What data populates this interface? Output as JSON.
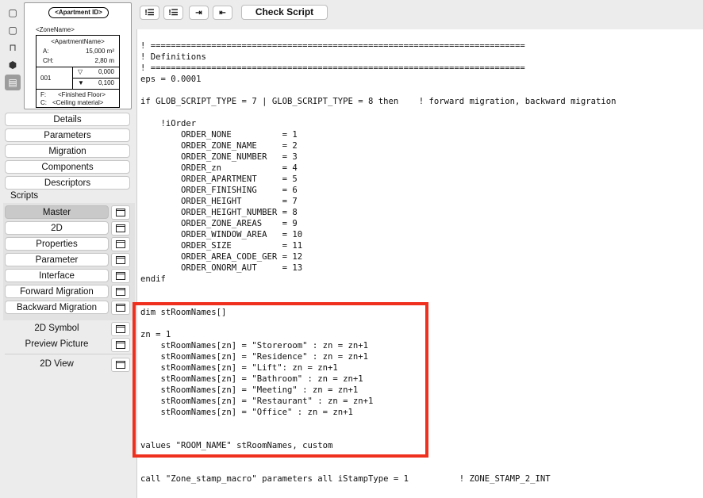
{
  "preview": {
    "apartment_id": "<Apartment ID>",
    "zone_name": "<ZoneName>",
    "apartment_name": "<ApartmentName>",
    "area_label": "A:",
    "area_value": "15,000 m²",
    "ch_label": "CH:",
    "ch_value": "2,80 m",
    "number": "001",
    "up_value": "0,000",
    "down_value": "0,100",
    "floor_label": "F:",
    "floor_value": "<Finished Floor>",
    "ceiling_label": "C:",
    "ceiling_value": "<Ceiling material>"
  },
  "nav": {
    "details": "Details",
    "parameters": "Parameters",
    "migration": "Migration",
    "components": "Components",
    "descriptors": "Descriptors"
  },
  "scripts": {
    "header": "Scripts",
    "items": [
      "Master",
      "2D",
      "Properties",
      "Parameter",
      "Interface",
      "Forward Migration",
      "Backward Migration"
    ],
    "symbol": "2D Symbol",
    "preview_picture": "Preview Picture",
    "view_2d": "2D View"
  },
  "toolbar": {
    "check_script": "Check Script"
  },
  "code": "! ==========================================================================\n! Definitions\n! ==========================================================================\neps = 0.0001\n\nif GLOB_SCRIPT_TYPE = 7 | GLOB_SCRIPT_TYPE = 8 then    ! forward migration, backward migration\n\n    !iOrder\n        ORDER_NONE          = 1\n        ORDER_ZONE_NAME     = 2\n        ORDER_ZONE_NUMBER   = 3\n        ORDER_zn            = 4\n        ORDER_APARTMENT     = 5\n        ORDER_FINISHING     = 6\n        ORDER_HEIGHT        = 7\n        ORDER_HEIGHT_NUMBER = 8\n        ORDER_ZONE_AREAS    = 9\n        ORDER_WINDOW_AREA   = 10\n        ORDER_SIZE          = 11\n        ORDER_AREA_CODE_GER = 12\n        ORDER_ONORM_AUT     = 13\nendif\n\n\ndim stRoomNames[]\n\nzn = 1\n    stRoomNames[zn] = \"Storeroom\" : zn = zn+1\n    stRoomNames[zn] = \"Residence\" : zn = zn+1\n    stRoomNames[zn] = \"Lift\": zn = zn+1\n    stRoomNames[zn] = \"Bathroom\" : zn = zn+1\n    stRoomNames[zn] = \"Meeting\" : zn = zn+1\n    stRoomNames[zn] = \"Restaurant\" : zn = zn+1\n    stRoomNames[zn] = \"Office\" : zn = zn+1\n\n\nvalues \"ROOM_NAME\" stRoomNames, custom\n\n\ncall \"Zone_stamp_macro\" parameters all iStampType = 1          ! ZONE_STAMP_2_INT",
  "colors": {
    "highlight": "#f0301f"
  }
}
